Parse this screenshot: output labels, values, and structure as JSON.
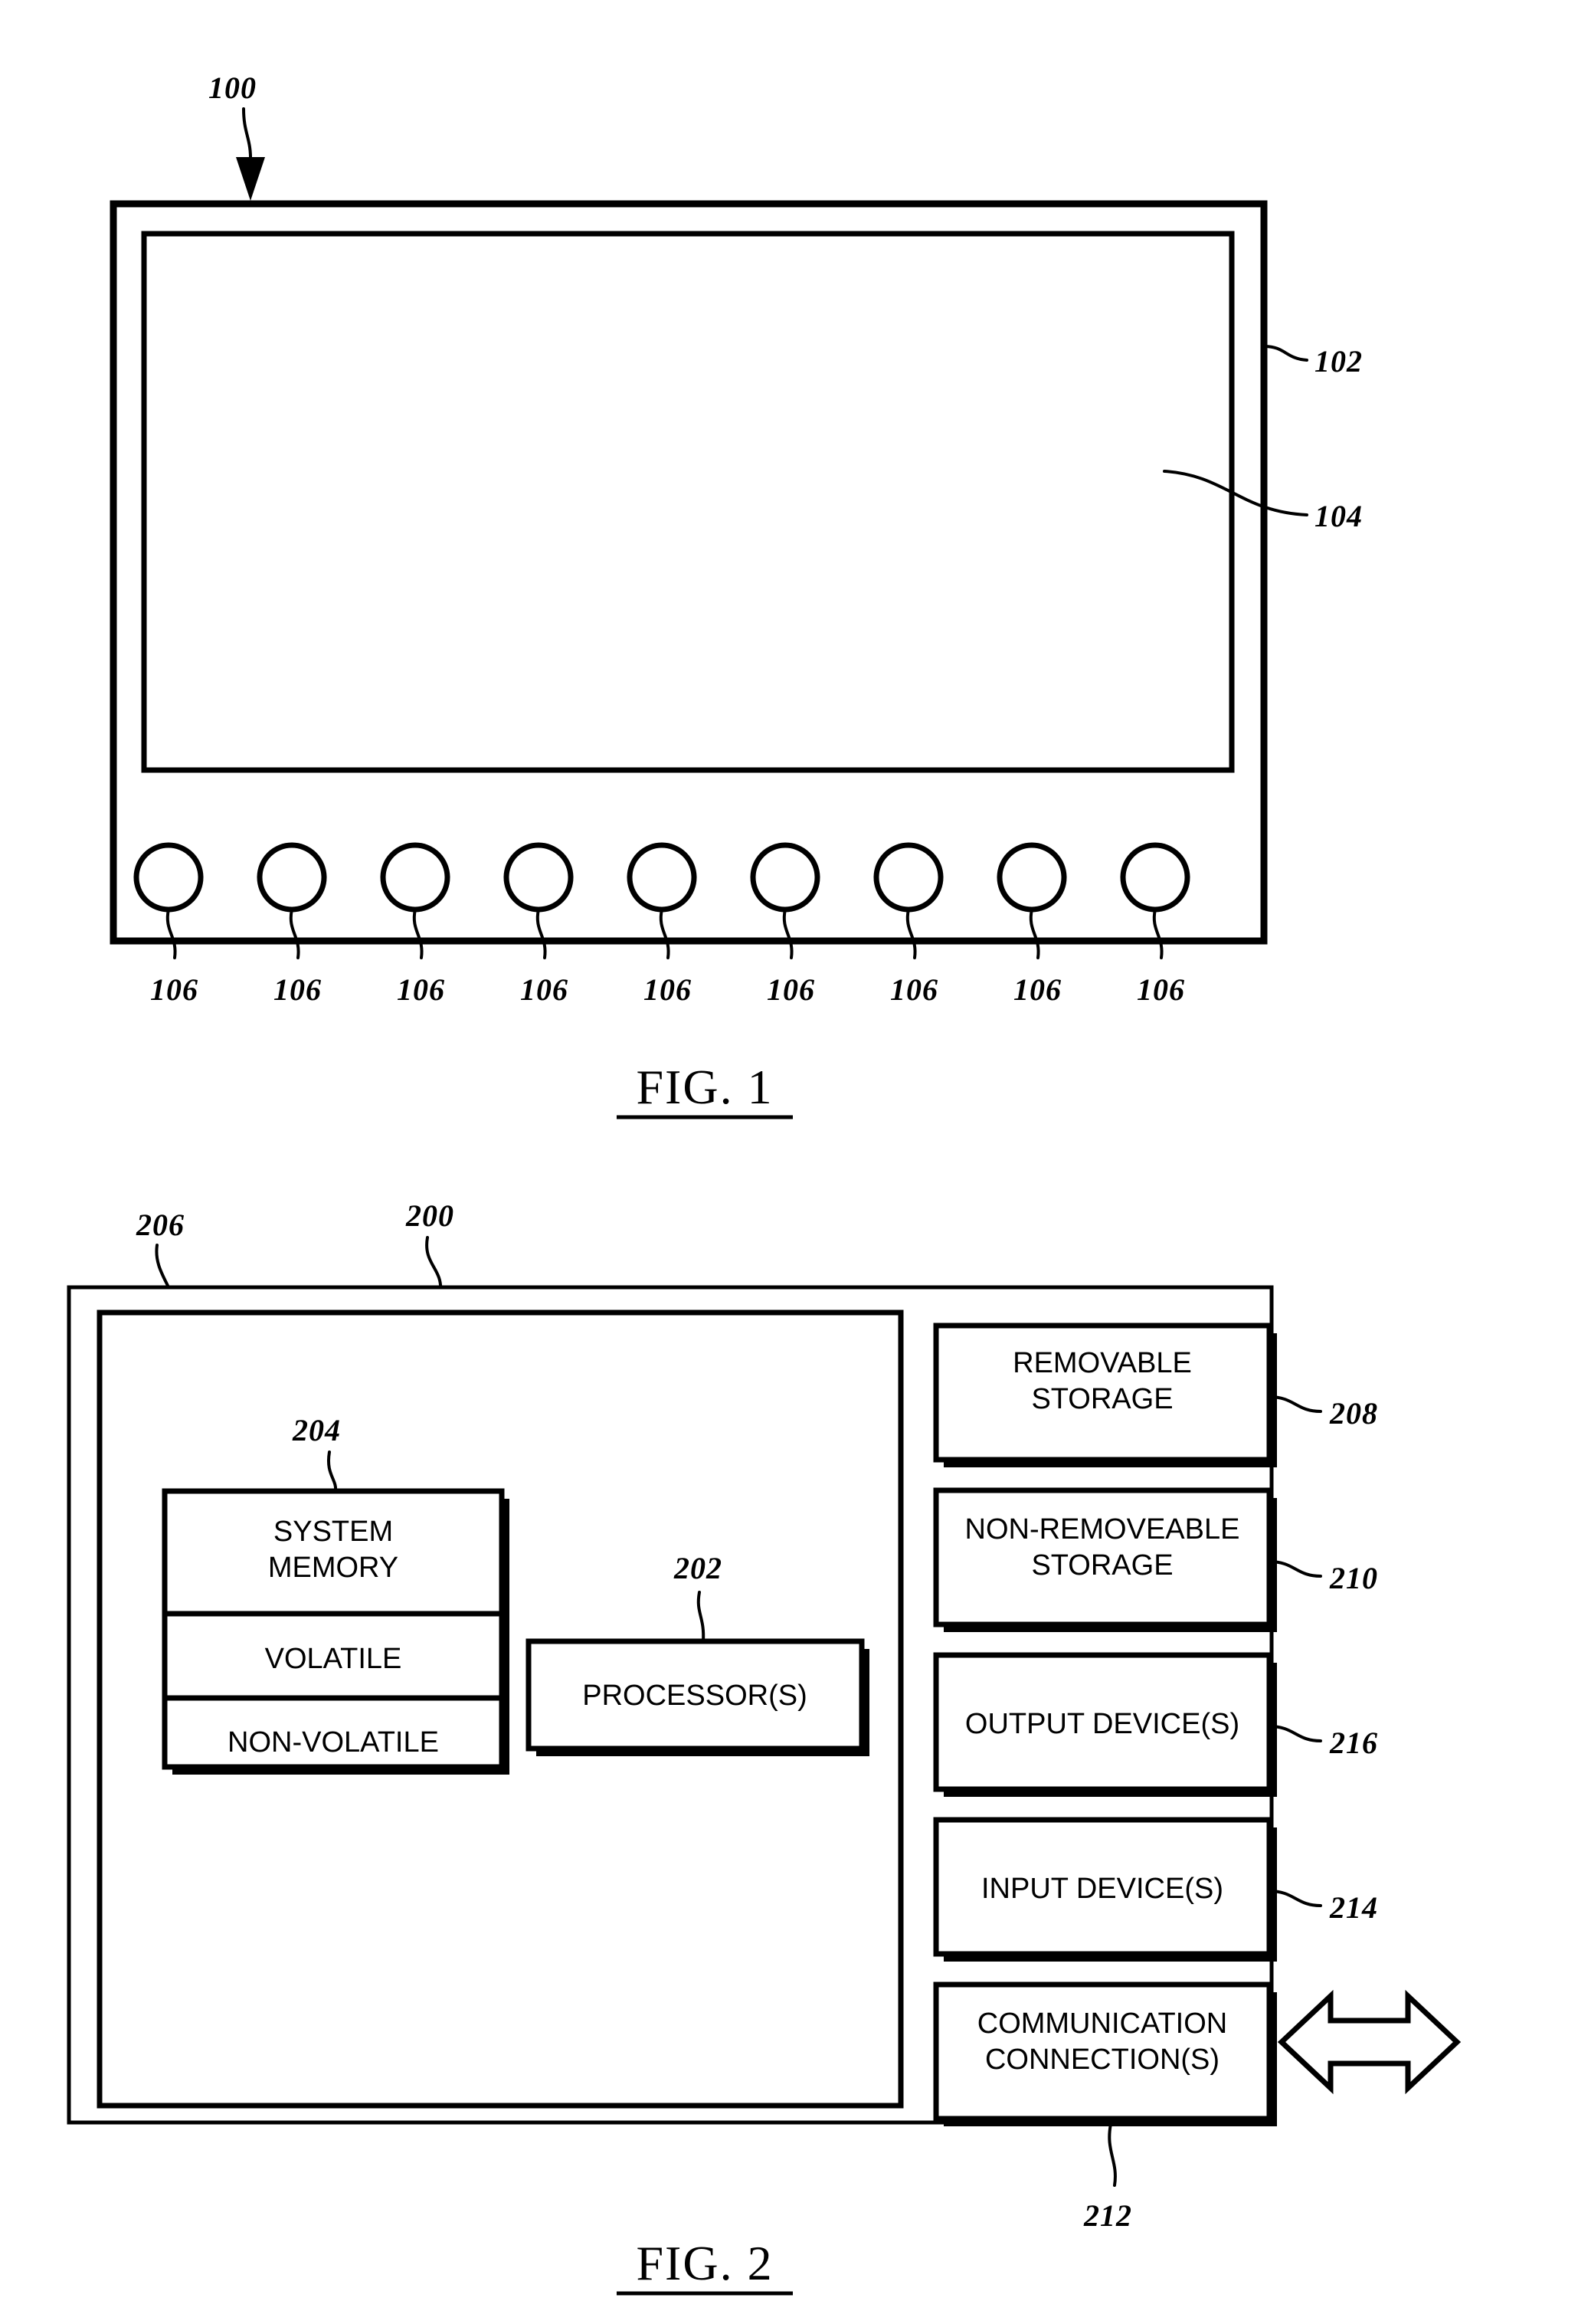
{
  "document": {
    "type": "patent-drawing-sheet",
    "figures": [
      {
        "caption": "FIG. 1",
        "title_number": "100",
        "reference_numerals": [
          {
            "label": "100",
            "target": "device"
          },
          {
            "label": "102",
            "target": "housing-bezel"
          },
          {
            "label": "104",
            "target": "display-screen"
          }
        ],
        "button_label": "106",
        "button_count": 9,
        "button_labels": [
          "106",
          "106",
          "106",
          "106",
          "106",
          "106",
          "106",
          "106",
          "106"
        ]
      },
      {
        "caption": "FIG. 2",
        "title_number": "200",
        "reference_numerals": [
          {
            "label": "200",
            "target": "computing-device"
          },
          {
            "label": "206",
            "target": "basic-configuration"
          },
          {
            "label": "204",
            "target": "system-memory"
          },
          {
            "label": "202",
            "target": "processors"
          },
          {
            "label": "208",
            "target": "removable-storage"
          },
          {
            "label": "210",
            "target": "non-removeable-storage"
          },
          {
            "label": "216",
            "target": "output-devices"
          },
          {
            "label": "214",
            "target": "input-devices"
          },
          {
            "label": "212",
            "target": "communication-connections"
          }
        ],
        "memory_block": {
          "title": "SYSTEM\nMEMORY",
          "title_line1": "SYSTEM",
          "title_line2": "MEMORY",
          "sections": [
            {
              "label": "VOLATILE"
            },
            {
              "label": "NON-VOLATILE"
            }
          ]
        },
        "processor_block": {
          "label": "PROCESSOR(S)"
        },
        "peripheral_blocks": [
          {
            "line1": "REMOVABLE",
            "line2": "STORAGE",
            "ref": "208"
          },
          {
            "line1": "NON-REMOVEABLE",
            "line2": "STORAGE",
            "ref": "210"
          },
          {
            "line1": "OUTPUT DEVICE(S)",
            "line2": "",
            "ref": "216"
          },
          {
            "line1": "INPUT DEVICE(S)",
            "line2": "",
            "ref": "214"
          },
          {
            "line1": "COMMUNICATION",
            "line2": "CONNECTION(S)",
            "ref": "212"
          }
        ],
        "external_connector": "double-headed-arrow"
      }
    ]
  },
  "colors": {
    "ink": "#000000",
    "paper": "#ffffff"
  }
}
